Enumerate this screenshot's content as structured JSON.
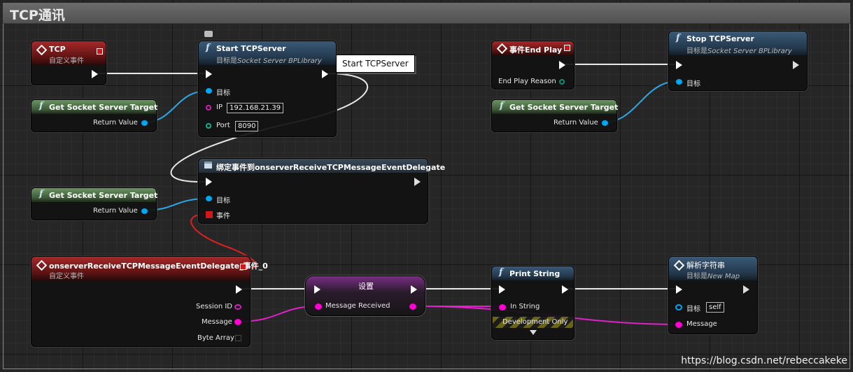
{
  "graph_title": "TCP通讯",
  "watermark": "https://blog.csdn.net/rebeccakeke",
  "tooltip": "Start TCPServer",
  "nodes": {
    "tcp_event": {
      "title": "TCP",
      "subtitle": "自定义事件"
    },
    "get_target_1": {
      "title": "Get Socket Server Target",
      "out": "Return Value"
    },
    "start_server": {
      "title": "Start TCPServer",
      "subtitle_prefix": "目标是",
      "subtitle_class": "Socket Server BPLibrary",
      "pin_target": "目标",
      "pin_ip": "IP",
      "ip_value": "192.168.21.39",
      "pin_port": "Port",
      "port_value": "8090"
    },
    "bind_event": {
      "title": "绑定事件到onserverReceiveTCPMessageEventDelegate",
      "pin_target": "目标",
      "pin_event": "事件"
    },
    "get_target_2": {
      "title": "Get Socket Server Target",
      "out": "Return Value"
    },
    "end_play": {
      "title": "事件End Play",
      "pin_reason": "End Play Reason"
    },
    "get_target_3": {
      "title": "Get Socket Server Target",
      "out": "Return Value"
    },
    "stop_server": {
      "title": "Stop TCPServer",
      "subtitle_prefix": "目标是",
      "subtitle_class": "Socket Server BPLibrary",
      "pin_target": "目标"
    },
    "recv_event": {
      "title": "onserverReceiveTCPMessageEventDelegate_事件_0",
      "subtitle": "自定义事件",
      "pin_session": "Session ID",
      "pin_message": "Message",
      "pin_bytes": "Byte Array"
    },
    "set_node": {
      "title": "设置",
      "pin_msg": "Message Received"
    },
    "print_string": {
      "title": "Print String",
      "pin_in": "In String",
      "dev_only": "Development Only",
      "expand_icon": "chevron-down-icon"
    },
    "parse_node": {
      "title": "解析字符串",
      "subtitle_prefix": "目标是",
      "subtitle_class": "New Map",
      "pin_target": "目标",
      "target_value": "self",
      "pin_message": "Message"
    }
  },
  "colors": {
    "exec": "#ffffff",
    "object": "#00a8f4",
    "string": "#ff00d4",
    "name": "#ff00d4",
    "enum": "#0a6e5c",
    "delegate": "#e02020",
    "byte": "#0a6e5c"
  }
}
